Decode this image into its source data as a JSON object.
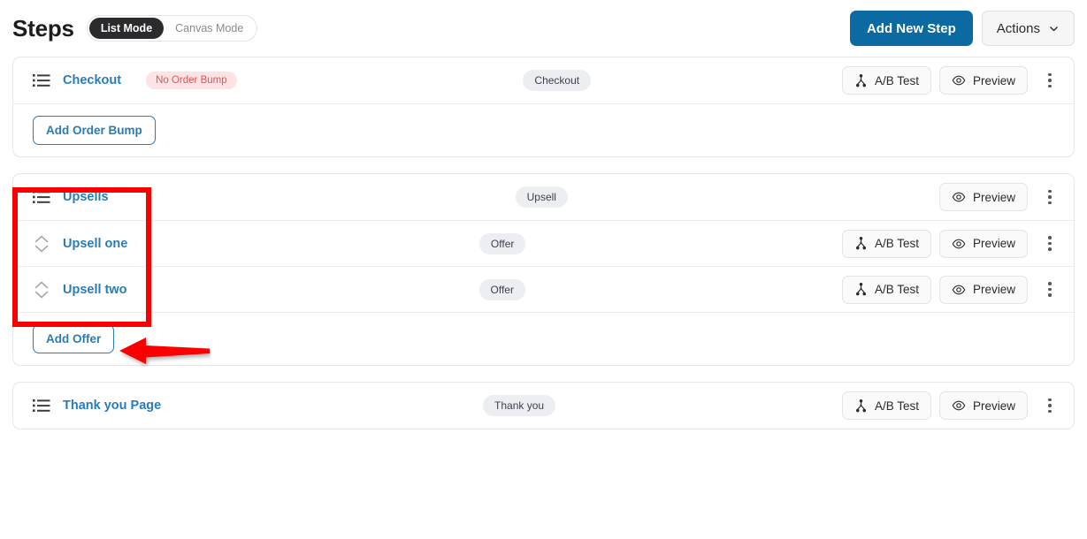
{
  "header": {
    "title": "Steps",
    "modes": [
      {
        "label": "List Mode",
        "active": true
      },
      {
        "label": "Canvas Mode",
        "active": false
      }
    ],
    "add_new_step_label": "Add New Step",
    "actions_label": "Actions",
    "actions_icon": "chevron-down-icon"
  },
  "common": {
    "ab_test_label": "A/B Test",
    "preview_label": "Preview",
    "ab_test_icon": "split-test-icon",
    "preview_icon": "eye-icon",
    "kebab_icon": "three-dots-vertical-icon",
    "list_icon": "list-icon",
    "sort_icon": "sort-up-down-icon"
  },
  "cards": [
    {
      "name": "checkout-card",
      "rows": [
        {
          "label": "Checkout",
          "icon": "list-icon",
          "badge": "No Order Bump",
          "badge_style": "danger",
          "type": "Checkout",
          "has_ab_test": true,
          "has_preview": true
        }
      ],
      "footer_button": "Add Order Bump"
    },
    {
      "name": "upsells-card",
      "rows": [
        {
          "label": "Upsells",
          "icon": "list-icon",
          "badge": "",
          "badge_style": "none",
          "type": "Upsell",
          "has_ab_test": false,
          "has_preview": true
        },
        {
          "label": "Upsell one",
          "icon": "sort-up-down-icon",
          "badge": "",
          "badge_style": "none",
          "type": "Offer",
          "has_ab_test": true,
          "has_preview": true
        },
        {
          "label": "Upsell two",
          "icon": "sort-up-down-icon",
          "badge": "",
          "badge_style": "none",
          "type": "Offer",
          "has_ab_test": true,
          "has_preview": true
        }
      ],
      "footer_button": "Add Offer"
    },
    {
      "name": "thank-you-card",
      "rows": [
        {
          "label": "Thank you Page",
          "icon": "list-icon",
          "badge": "",
          "badge_style": "none",
          "type": "Thank you",
          "has_ab_test": true,
          "has_preview": true
        }
      ],
      "footer_button": ""
    }
  ],
  "annotations": [
    {
      "type": "rectangle",
      "name": "upsells-highlight-rect",
      "color": "#fb0000"
    },
    {
      "type": "arrow",
      "name": "add-offer-pointer-arrow",
      "color": "#fb0000",
      "direction": "left"
    }
  ],
  "colors": {
    "primary": "#0a6aa1",
    "link": "#2a7cb8",
    "danger_badge_bg": "#fde3e3",
    "danger_badge_text": "#e0555a",
    "type_badge_bg": "#eceef1",
    "annotation": "#fb0000"
  }
}
